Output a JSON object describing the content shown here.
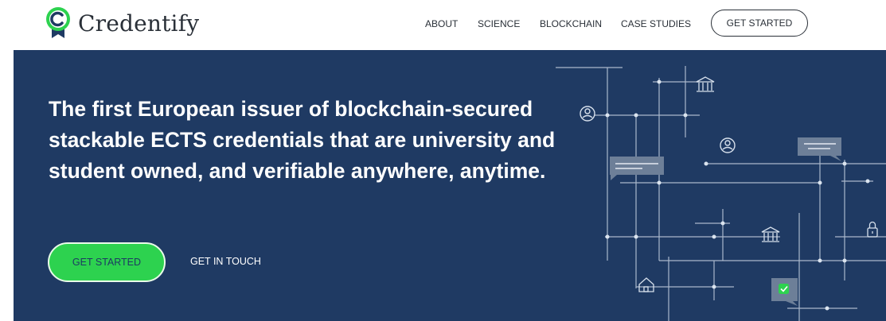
{
  "brand": {
    "name": "Credentify",
    "logo_icon": "credential-badge-icon",
    "accent": "#2dd24f"
  },
  "nav": {
    "items": [
      {
        "label": "ABOUT"
      },
      {
        "label": "SCIENCE"
      },
      {
        "label": "BLOCKCHAIN"
      },
      {
        "label": "CASE STUDIES"
      }
    ],
    "cta_label": "GET STARTED"
  },
  "hero": {
    "headline": "The first European issuer of blockchain-secured stackable ECTS credentials that are university and student owned, and verifiable anywhere, anytime.",
    "primary_cta": "GET STARTED",
    "secondary_cta": "GET IN TOUCH",
    "background": "#1f3a63"
  },
  "illustration": {
    "icons": [
      "user-icon",
      "user-icon",
      "institution-icon",
      "institution-icon",
      "document-icon",
      "document-icon",
      "lock-icon",
      "home-icon",
      "checkmark-icon"
    ]
  }
}
